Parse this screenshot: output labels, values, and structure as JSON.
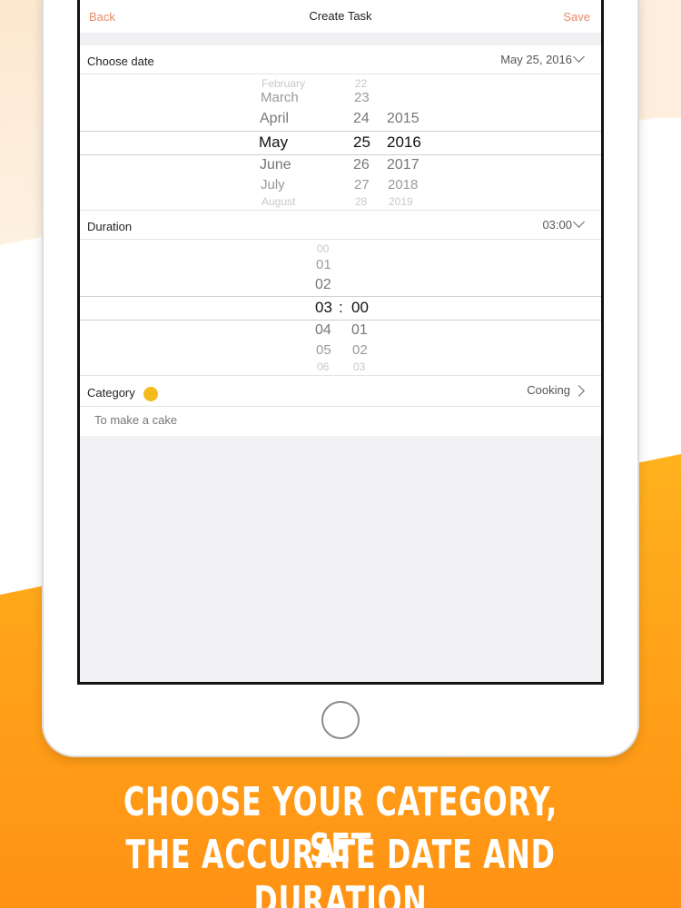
{
  "nav": {
    "back": "Back",
    "title": "Create Task",
    "save": "Save"
  },
  "date_row": {
    "label": "Choose date",
    "value": "May 25, 2016",
    "icon": "chevron-down-icon"
  },
  "date_picker": {
    "months": [
      "February",
      "March",
      "April",
      "May",
      "June",
      "July",
      "August"
    ],
    "days": [
      "22",
      "23",
      "24",
      "25",
      "26",
      "27",
      "28"
    ],
    "years": [
      "2015",
      "2016",
      "2017",
      "2018",
      "2019"
    ],
    "selected": {
      "month": "May",
      "day": "25",
      "year": "2016"
    }
  },
  "duration_row": {
    "label": "Duration",
    "value": "03:00",
    "icon": "chevron-down-icon"
  },
  "duration_picker": {
    "hours": [
      "00",
      "01",
      "02",
      "03",
      "04",
      "05",
      "06"
    ],
    "minutes": [
      "00",
      "01",
      "02",
      "03"
    ],
    "separator": ":",
    "selected": {
      "hours": "03",
      "minutes": "00"
    }
  },
  "category_row": {
    "label": "Category",
    "value": "Cooking",
    "dot_color": "#f4bc1b",
    "icon": "chevron-right-icon"
  },
  "note": {
    "text": "To make a cake"
  },
  "caption": {
    "line1": "CHOOSE YOUR CATEGORY, SET",
    "line2": "THE ACCURATE DATE AND DURATION"
  },
  "colors": {
    "accent": "#e98a6a",
    "orange": "#ffa41a",
    "category_dot": "#f4bc1b"
  }
}
